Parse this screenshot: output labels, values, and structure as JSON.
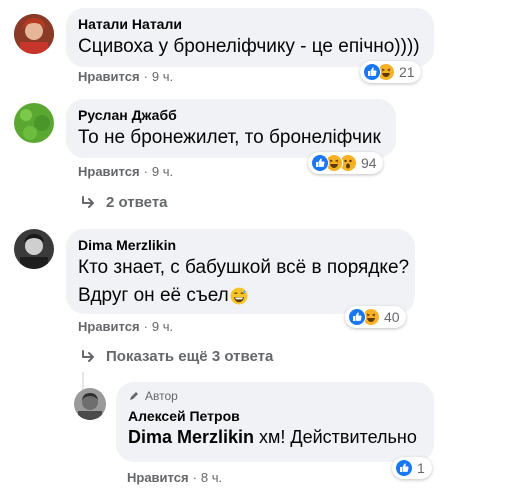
{
  "comments": [
    {
      "author": "Натали Натали",
      "text": "Сцивоха у бронеліфчику - це епічно))))",
      "like_label": "Нравится",
      "time": "9 ч.",
      "reaction_count": "21",
      "reactions": [
        "like-icon",
        "haha-icon"
      ]
    },
    {
      "author": "Руслан Джабб",
      "text": "То не бронежилет, то бронеліфчик",
      "like_label": "Нравится",
      "time": "9 ч.",
      "reaction_count": "94",
      "reactions": [
        "like-icon",
        "haha-icon",
        "wow-icon"
      ],
      "replies_label": "2 ответа"
    },
    {
      "author": "Dima Merzlikin",
      "text_line1": "Кто знает, с бабушкой всё в порядке?",
      "text_line2": "Вдруг он её съел",
      "emoji": "grinning-sweat-emoji",
      "like_label": "Нравится",
      "time": "9 ч.",
      "reaction_count": "40",
      "reactions": [
        "like-icon",
        "haha-icon"
      ],
      "replies_label": "Показать ещё 3 ответа"
    }
  ],
  "reply": {
    "badge": "Автор",
    "author": "Алексей Петров",
    "mention": "Dima Merzlikin",
    "text": " хм! Действительно",
    "like_label": "Нравится",
    "time": "8 ч.",
    "reaction_count": "1",
    "reactions": [
      "like-icon"
    ]
  },
  "colors": {
    "bubble": "#f0f2f5",
    "meta_text": "#65676b",
    "like_blue": "#1877f2",
    "haha_yellow": "#f7b125"
  }
}
